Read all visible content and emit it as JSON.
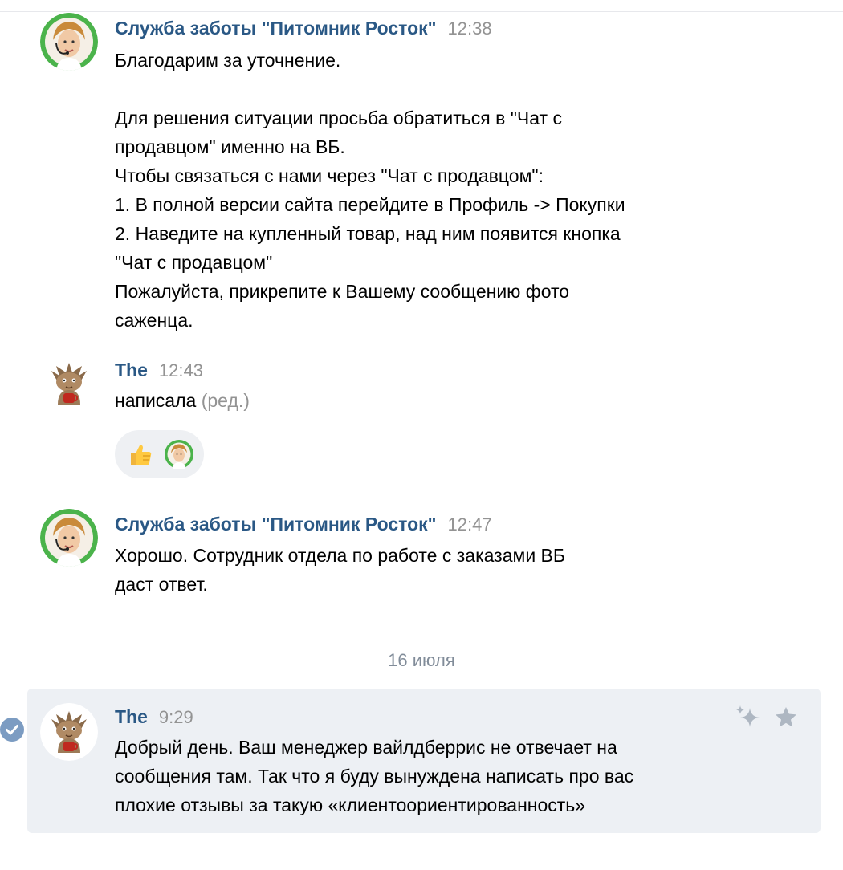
{
  "messages": [
    {
      "author": "Служба заботы \"Питомник Росток\"",
      "time": "12:38",
      "lines": [
        "Благодарим за уточнение.",
        "",
        "Для решения ситуации просьба обратиться в \"Чат с",
        "продавцом\" именно на ВБ.",
        "Чтобы связаться с нами через \"Чат с продавцом\":",
        "1. В полной версии сайта перейдите в Профиль -> Покупки",
        "2. Наведите на купленный товар, над ним появится кнопка",
        "\"Чат с продавцом\"",
        "Пожалуйста, прикрепите к Вашему сообщению фото",
        "саженца."
      ]
    },
    {
      "author": "The",
      "time": "12:43",
      "text": "написала",
      "edited": "(ред.)",
      "reactions": [
        "thumbs-up",
        "support-avatar"
      ]
    },
    {
      "author": "Служба заботы \"Питомник Росток\"",
      "time": "12:47",
      "lines": [
        "Хорошо. Сотрудник отдела по работе с заказами ВБ",
        "даст ответ."
      ]
    },
    {
      "author": "The",
      "time": "9:29",
      "lines": [
        "Добрый день. Ваш менеджер вайлдберрис не отвечает на",
        "сообщения там. Так что я буду вынуждена написать про вас",
        "плохие отзывы за такую «клиентоориентированность»"
      ]
    }
  ],
  "date_separator": "16 июля",
  "colors": {
    "author": "#2a5885",
    "time": "#939393",
    "highlight_bg": "#edf0f4",
    "avatar_ring": "#4bb34b"
  }
}
